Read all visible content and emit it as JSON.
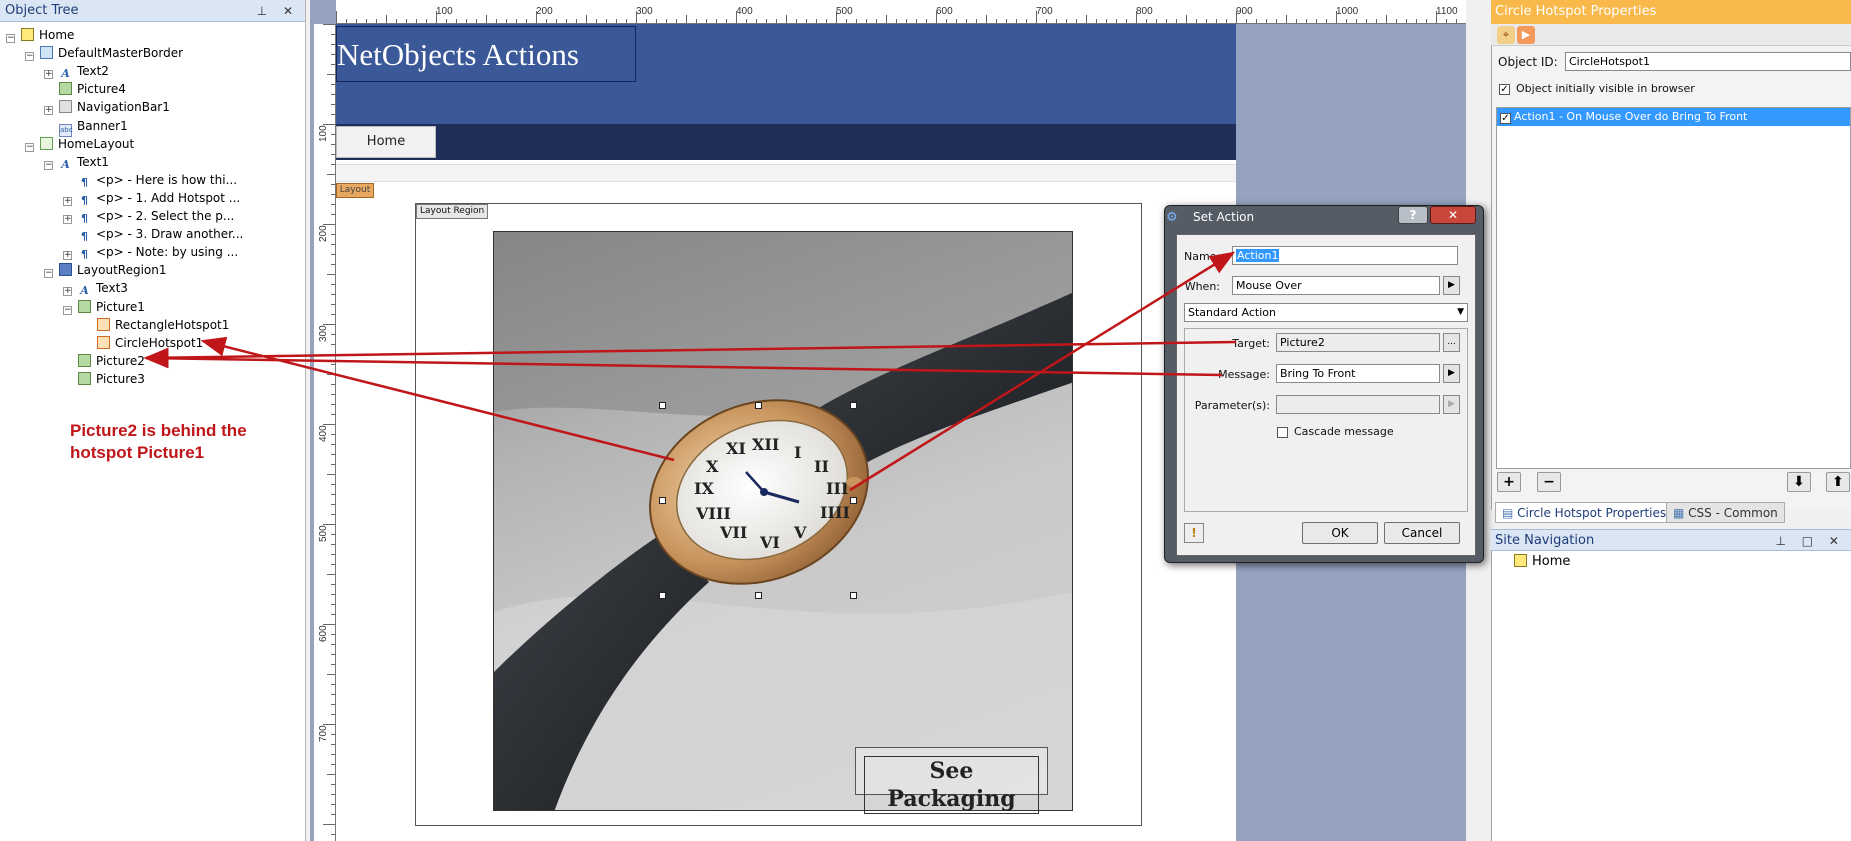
{
  "object_tree": {
    "title": "Object Tree",
    "header_buttons": "⊥ ✕",
    "items": [
      {
        "label": "Home",
        "icon": "home-page-icon",
        "expander": "−"
      },
      {
        "label": "DefaultMasterBorder",
        "icon": "master-border-icon",
        "expander": "−"
      },
      {
        "label": "Text2",
        "icon": "text-icon",
        "expander": "+"
      },
      {
        "label": "Picture4",
        "icon": "picture-icon",
        "expander": ""
      },
      {
        "label": "NavigationBar1",
        "icon": "navbar-icon",
        "expander": "+"
      },
      {
        "label": "Banner1",
        "icon": "banner-icon",
        "expander": ""
      },
      {
        "label": "HomeLayout",
        "icon": "layout-icon",
        "expander": "−"
      },
      {
        "label": "Text1",
        "icon": "text-icon",
        "expander": "−"
      },
      {
        "label": "<p> - Here is how thi...",
        "icon": "paragraph-icon",
        "expander": ""
      },
      {
        "label": "<p> - 1. Add Hotspot ...",
        "icon": "paragraph-icon",
        "expander": "+"
      },
      {
        "label": "<p> - 2. Select the p...",
        "icon": "paragraph-icon",
        "expander": "+"
      },
      {
        "label": "<p> - 3. Draw another...",
        "icon": "paragraph-icon",
        "expander": ""
      },
      {
        "label": "<p> - Note: by using ...",
        "icon": "paragraph-icon",
        "expander": "+"
      },
      {
        "label": "LayoutRegion1",
        "icon": "layout-region-icon",
        "expander": "−"
      },
      {
        "label": "Text3",
        "icon": "text-icon",
        "expander": "+"
      },
      {
        "label": "Picture1",
        "icon": "picture-icon",
        "expander": "−"
      },
      {
        "label": "RectangleHotspot1",
        "icon": "hotspot-icon",
        "expander": ""
      },
      {
        "label": "CircleHotspot1",
        "icon": "hotspot-icon",
        "expander": ""
      },
      {
        "label": "Picture2",
        "icon": "picture-icon",
        "expander": ""
      },
      {
        "label": "Picture3",
        "icon": "picture-icon",
        "expander": ""
      }
    ]
  },
  "annotation": {
    "line1": "Picture2 is behind the",
    "line2": "hotspot Picture1"
  },
  "ruler": {
    "top_labels": [
      "100",
      "200",
      "300",
      "400",
      "500",
      "600",
      "700",
      "800",
      "900",
      "1000",
      "1100"
    ],
    "left_labels": [
      "100",
      "200",
      "300",
      "400",
      "500",
      "600",
      "700"
    ]
  },
  "page": {
    "banner_title": "NetObjects Actions",
    "nav_home": "Home",
    "layout_tag": "Layout",
    "layout_region_label": "Layout Region",
    "see_packaging": "See Packaging"
  },
  "dialog": {
    "title": "Set Action",
    "help": "?",
    "close": "✕",
    "name_label": "Name:",
    "name_value": "Action1",
    "when_label": "When:",
    "when_value": "Mouse Over",
    "action_type": "Standard Action",
    "target_label": "Target:",
    "target_value": "Picture2",
    "message_label": "Message:",
    "message_value": "Bring To Front",
    "parameters_label": "Parameter(s):",
    "parameters_value": "",
    "cascade_label": "Cascade message",
    "ok": "OK",
    "cancel": "Cancel",
    "browse": "...",
    "warning": "!"
  },
  "properties": {
    "title": "Circle Hotspot Properties",
    "object_id_label": "Object ID:",
    "object_id_value": "CircleHotspot1",
    "visible_label": "Object initially visible in browser",
    "action_item": "Action1 - On Mouse Over do Bring To Front",
    "add": "+",
    "remove": "−",
    "move_down": "⬇",
    "move_up": "⬆",
    "tab_props": "Circle Hotspot Properties",
    "tab_css": "CSS - Common"
  },
  "site_navigation": {
    "title": "Site Navigation",
    "header_buttons": "⊥ □ ✕",
    "home": "Home"
  },
  "colors": {
    "annotation_red": "#c0161a",
    "banner_blue": "#3b5998",
    "selection_blue": "#3399ff",
    "properties_header_orange": "#f9b94a"
  }
}
